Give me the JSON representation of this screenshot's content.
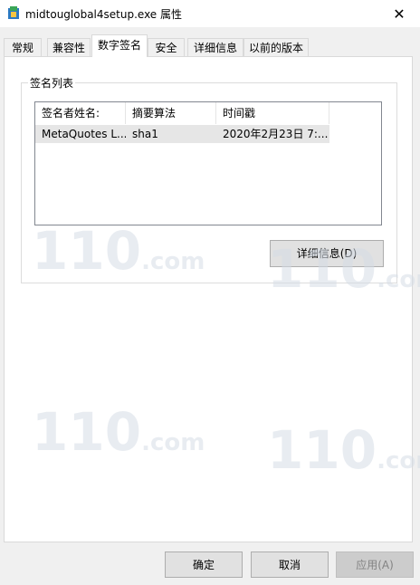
{
  "window": {
    "title": "midtouglobal4setup.exe 属性",
    "close_glyph": "✕"
  },
  "tabs": [
    {
      "label": "常规"
    },
    {
      "label": "兼容性"
    },
    {
      "label": "数字签名",
      "active": true
    },
    {
      "label": "安全"
    },
    {
      "label": "详细信息"
    },
    {
      "label": "以前的版本"
    }
  ],
  "signature_list": {
    "group_label": "签名列表",
    "columns": [
      "签名者姓名:",
      "摘要算法",
      "时间戳"
    ],
    "rows": [
      {
        "signer": "MetaQuotes L...",
        "digest": "sha1",
        "timestamp": "2020年2月23日 7:..."
      }
    ],
    "details_button": "详细信息(D)"
  },
  "footer": {
    "ok": "确定",
    "cancel": "取消",
    "apply": "应用(A)"
  },
  "watermark": {
    "text": "110",
    "suffix": ".com"
  },
  "colors": {
    "selected_row": "#e6e6e6",
    "listview_border": "#828790"
  }
}
